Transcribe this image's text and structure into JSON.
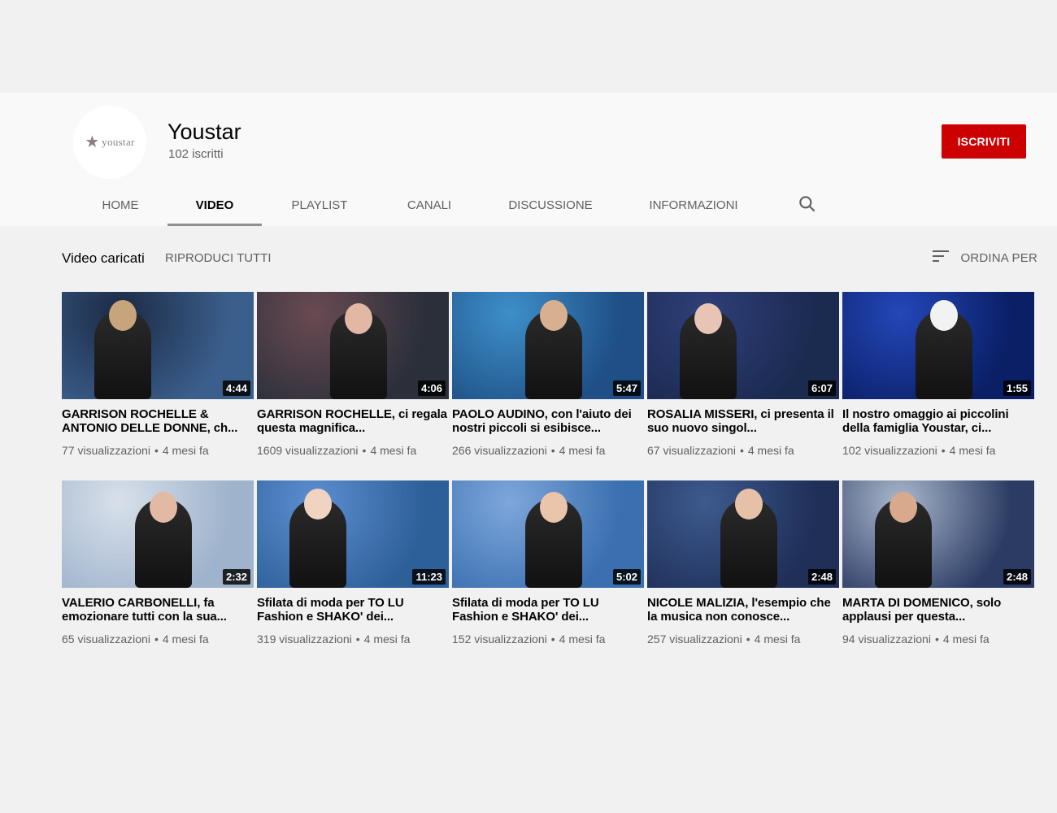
{
  "channel": {
    "name": "Youstar",
    "subscribers": "102 iscritti",
    "logo_text": "youstar",
    "subscribe_label": "ISCRIVITI",
    "accent_color": "#cc0000"
  },
  "tabs": [
    {
      "label": "HOME",
      "active": false
    },
    {
      "label": "VIDEO",
      "active": true
    },
    {
      "label": "PLAYLIST",
      "active": false
    },
    {
      "label": "CANALI",
      "active": false
    },
    {
      "label": "DISCUSSIONE",
      "active": false
    },
    {
      "label": "INFORMAZIONI",
      "active": false
    }
  ],
  "tab_search_icon": "search-icon",
  "section": {
    "title": "Video caricati",
    "play_all": "RIPRODUCI TUTTI",
    "sort_label": "ORDINA PER",
    "sort_icon": "sort-icon"
  },
  "videos": [
    {
      "title": "GARRISON ROCHELLE & ANTONIO DELLE DONNE, ch...",
      "duration": "4:44",
      "views": "77 visualizzazioni",
      "age": "4 mesi fa",
      "thumb_colors": [
        "#3b5f8c",
        "#1c2a45",
        "#c8a47c"
      ]
    },
    {
      "title": "GARRISON ROCHELLE, ci regala questa magnifica...",
      "duration": "4:06",
      "views": "1609 visualizzazioni",
      "age": "4 mesi fa",
      "thumb_colors": [
        "#2a2f3a",
        "#6a4a52",
        "#e2b8a4"
      ]
    },
    {
      "title": "PAOLO AUDINO, con l'aiuto dei nostri piccoli si esibisce...",
      "duration": "5:47",
      "views": "266 visualizzazioni",
      "age": "4 mesi fa",
      "thumb_colors": [
        "#1f4f86",
        "#3e8fc9",
        "#d9b08f"
      ]
    },
    {
      "title": "ROSALIA MISSERI, ci presenta il suo nuovo singol...",
      "duration": "6:07",
      "views": "67 visualizzazioni",
      "age": "4 mesi fa",
      "thumb_colors": [
        "#1b2a4f",
        "#2f3f7a",
        "#e8c4b4"
      ]
    },
    {
      "title": "Il nostro omaggio ai piccolini della famiglia Youstar, ci...",
      "duration": "1:55",
      "views": "102 visualizzazioni",
      "age": "4 mesi fa",
      "thumb_colors": [
        "#0a1f66",
        "#2447b8",
        "#f2f2f2"
      ]
    },
    {
      "title": "VALERIO CARBONELLI, fa emozionare tutti con la sua...",
      "duration": "2:32",
      "views": "65 visualizzazioni",
      "age": "4 mesi fa",
      "thumb_colors": [
        "#9fb3cc",
        "#d8e0ea",
        "#e2b9a2"
      ]
    },
    {
      "title": "Sfilata di moda per TO LU Fashion e SHAKO' dei...",
      "duration": "11:23",
      "views": "319 visualizzazioni",
      "age": "4 mesi fa",
      "thumb_colors": [
        "#2d5f99",
        "#5d8ed0",
        "#f1d3c2"
      ]
    },
    {
      "title": "Sfilata di moda per TO LU Fashion e SHAKO' dei...",
      "duration": "5:02",
      "views": "152 visualizzazioni",
      "age": "4 mesi fa",
      "thumb_colors": [
        "#3a6fb0",
        "#7ea7db",
        "#eac4ab"
      ]
    },
    {
      "title": "NICOLE MALIZIA, l'esempio che la musica non conosce...",
      "duration": "2:48",
      "views": "257 visualizzazioni",
      "age": "4 mesi fa",
      "thumb_colors": [
        "#1f2f58",
        "#3d5a8e",
        "#e6c1a8"
      ]
    },
    {
      "title": "MARTA DI DOMENICO, solo applausi per questa...",
      "duration": "2:48",
      "views": "94 visualizzazioni",
      "age": "4 mesi fa",
      "thumb_colors": [
        "#2b3b63",
        "#a9b7cc",
        "#d9a98e"
      ]
    }
  ]
}
